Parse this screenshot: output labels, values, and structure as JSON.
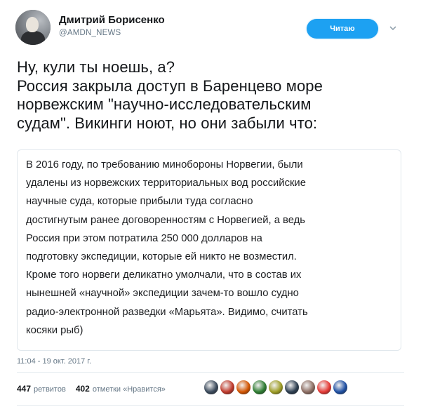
{
  "author": {
    "name": "Дмитрий Борисенко",
    "handle": "@AMDN_NEWS"
  },
  "follow_button": {
    "label": "Читаю"
  },
  "tweet": {
    "lines": [
      "Ну, кули ты ноешь, а?",
      "Россия закрыла доступ в Баренцево море",
      "норвежским \"научно-исследовательским",
      "судам\". Викинги ноют, но они забыли что:"
    ]
  },
  "quote": {
    "lines": [
      "В 2016 году, по требованию минобороны Норвегии, были",
      "удалены из норвежских территориальных вод российские",
      "научные суда, которые прибыли туда согласно",
      "достигнутым ранее договоренностям с Норвегией, а ведь",
      "Россия при этом потратила 250 000 долларов на",
      "подготовку экспедиции, которые ей никто не возместил.",
      "Кроме того норвеги деликатно умолчали, что в состав их",
      "нынешней «научной» экспедиции зачем-то вошло судно",
      "радио-электронной разведки «Марьята». Видимо, считать",
      "косяки рыб)"
    ]
  },
  "timestamp": "11:04 - 19 окт. 2017 г.",
  "stats": {
    "retweets_count": "447",
    "retweets_label": "ретвитов",
    "likes_count": "402",
    "likes_label": "отметки «Нравится»"
  },
  "likers": [
    {
      "icon": "liker-avatar-1",
      "color": "#3b4a5c"
    },
    {
      "icon": "liker-avatar-2",
      "color": "#c0392b"
    },
    {
      "icon": "liker-avatar-3",
      "color": "#d35400"
    },
    {
      "icon": "liker-avatar-4",
      "color": "#2e7d32"
    },
    {
      "icon": "liker-avatar-5",
      "color": "#9e9d24"
    },
    {
      "icon": "liker-avatar-6",
      "color": "#2c3e50"
    },
    {
      "icon": "liker-avatar-7",
      "color": "#8d6e63"
    },
    {
      "icon": "liker-avatar-8",
      "color": "#e53935"
    },
    {
      "icon": "liker-avatar-9",
      "color": "#1e4fa3"
    }
  ],
  "colors": {
    "accent": "#1da1f2",
    "secondary_text": "#657786",
    "border": "#e1e8ed"
  }
}
